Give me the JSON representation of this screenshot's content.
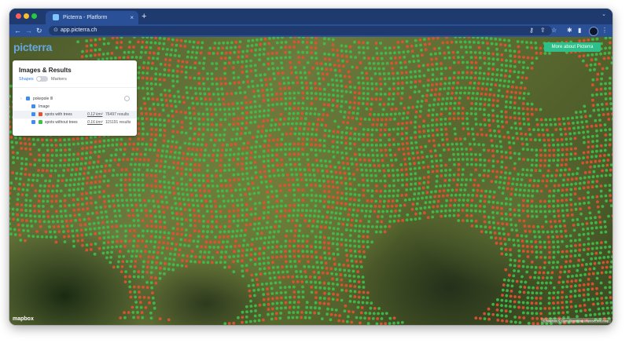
{
  "browser": {
    "tab_title": "Picterra - Platform",
    "tab_close": "×",
    "new_tab": "+",
    "tab_menu": "⌄",
    "url": "app.picterra.ch",
    "icons": [
      "back-icon",
      "forward-icon",
      "reload-icon",
      "lock-icon",
      "key-icon",
      "share-icon",
      "star-icon",
      "extensions-icon",
      "sidepanel-icon",
      "profile-icon",
      "menu-icon"
    ],
    "nav": {
      "back": "←",
      "forward": "→",
      "reload": "↻",
      "lock": "⊙"
    },
    "tools": {
      "key": "⚷",
      "share": "⇪",
      "star": "☆",
      "ext": "✱",
      "side": "▮",
      "menu": "⋮"
    }
  },
  "map": {
    "logo": "picterra",
    "more_button": "More about Picterra",
    "mapbox_logo": "mapbox",
    "attribution": "© Mapbox © OpenStreetMap Improve this map",
    "colors": {
      "tree_marker": "#e4522e",
      "no_tree_marker": "#3fc04a"
    }
  },
  "panel": {
    "title": "Images & Results",
    "toggle_left": "Shapes",
    "toggle_right": "Markers",
    "folder": {
      "label": "pokepole lll"
    },
    "image": {
      "label": "Image"
    },
    "layers": [
      {
        "label": "spots with trees",
        "area": "0.12 km²",
        "results": "76497 results",
        "color": "#e4522e"
      },
      {
        "label": "spots without trees",
        "area": "0.16 km²",
        "results": "115191 results",
        "color": "#3fc04a"
      }
    ]
  }
}
